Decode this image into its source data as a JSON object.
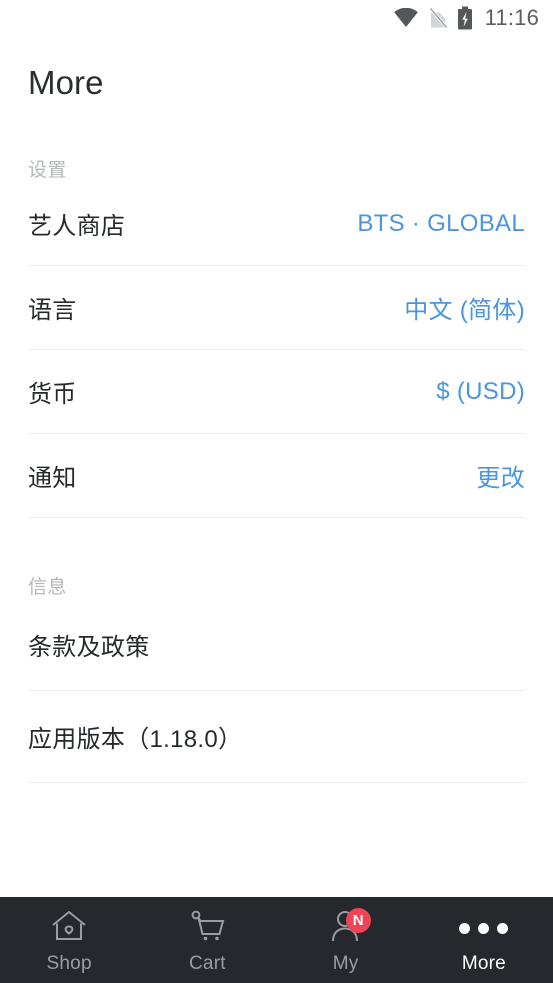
{
  "status_bar": {
    "time": "11:16",
    "icons": [
      "wifi-icon",
      "sim-off-icon",
      "battery-charging-icon"
    ]
  },
  "header": {
    "title": "More"
  },
  "sections": [
    {
      "id": "settings",
      "header": "设置",
      "rows": [
        {
          "label": "艺人商店",
          "value": "BTS · GLOBAL"
        },
        {
          "label": "语言",
          "value": "中文 (简体)"
        },
        {
          "label": "货币",
          "value": "$ (USD)"
        },
        {
          "label": "通知",
          "value": "更改"
        }
      ]
    },
    {
      "id": "info",
      "header": "信息",
      "rows": [
        {
          "label": "条款及政策",
          "value": ""
        },
        {
          "label": "应用版本（1.18.0）",
          "value": ""
        }
      ]
    }
  ],
  "bottom_nav": {
    "items": [
      {
        "label": "Shop",
        "icon": "home-icon",
        "active": false,
        "badge": ""
      },
      {
        "label": "Cart",
        "icon": "cart-icon",
        "active": false,
        "badge": ""
      },
      {
        "label": "My",
        "icon": "person-icon",
        "active": false,
        "badge": "N"
      },
      {
        "label": "More",
        "icon": "ellipsis-icon",
        "active": true,
        "badge": ""
      }
    ]
  },
  "colors": {
    "accent_blue": "#4a94e0",
    "badge_red": "#ef4456",
    "nav_background": "#25282d",
    "text_primary": "#26292c",
    "text_muted": "#b4b7ba"
  }
}
